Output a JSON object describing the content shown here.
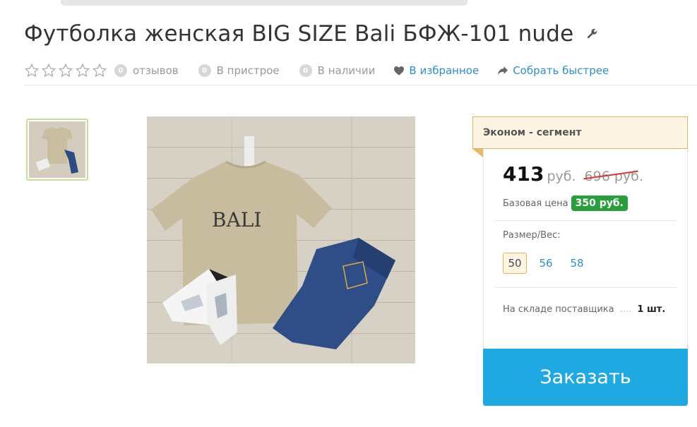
{
  "product": {
    "title": "Футболка женская BIG SIZE Bali БФЖ-101 nude"
  },
  "meta": {
    "reviews_count": "0",
    "reviews_label": "отзывов",
    "pristroy_count": "0",
    "pristroy_label": "В пристрое",
    "stock_count": "0",
    "stock_label": "В наличии",
    "favorites_label": "В избранное",
    "collect_label": "Собрать быстрее"
  },
  "offer": {
    "segment": "Эконом - сегмент",
    "price": "413",
    "currency": "руб.",
    "old_price": "696 руб.",
    "base_price_label": "Базовая цена",
    "base_price": "350 руб.",
    "size_label": "Размер/Вес:",
    "sizes": [
      "50",
      "56",
      "58"
    ],
    "stock_text": "На складе поставщика",
    "stock_dots": "....",
    "stock_qty": "1 шт.",
    "order_label": "Заказать"
  },
  "photo": {
    "shirt_print": "BALI"
  },
  "colors": {
    "link": "#2f8fc4",
    "order_button": "#20a8e3",
    "base_price_badge": "#2a9d3e",
    "segment_border": "#e3b35c",
    "strike": "#d23b3b"
  },
  "icons": {
    "edit": "wrench-icon",
    "favorites": "heart-icon",
    "collect": "share-arrow-icon",
    "rating": "star-outline-icon"
  }
}
